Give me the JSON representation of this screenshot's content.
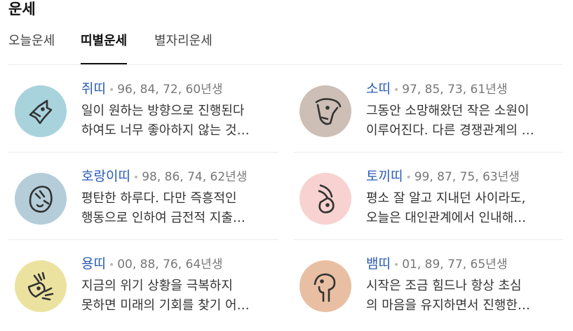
{
  "section_title": "운세",
  "tabs": [
    {
      "label": "오늘운세"
    },
    {
      "label": "띠별운세"
    },
    {
      "label": "별자리운세"
    }
  ],
  "active_tab": "띠별운세",
  "cards": [
    {
      "name": "쥐띠",
      "years": "96, 84, 72, 60년생",
      "line1": "일이 원하는 방향으로 진행된다",
      "line2": "하여도 너무 좋아하지 않는 것…",
      "icon": "rat-icon",
      "color": "#a8d3dc"
    },
    {
      "name": "소띠",
      "years": "97, 85, 73, 61년생",
      "line1": "그동안 소망해왔던 작은 소원이",
      "line2": "이루어진다. 다른 경쟁관계의 …",
      "icon": "ox-icon",
      "color": "#cdbfb6"
    },
    {
      "name": "호랑이띠",
      "years": "98, 86, 74, 62년생",
      "line1": "평탄한 하루다. 다만 즉흥적인",
      "line2": "행동으로 인하여 금전적 지출…",
      "icon": "tiger-icon",
      "color": "#b4cdd9"
    },
    {
      "name": "토끼띠",
      "years": "99, 87, 75, 63년생",
      "line1": "평소 잘 알고 지내던 사이라도,",
      "line2": "오늘은 대인관계에서 인내해…",
      "icon": "rabbit-icon",
      "color": "#f8d2d0"
    },
    {
      "name": "용띠",
      "years": "00, 88, 76, 64년생",
      "line1": "지금의 위기 상황을 극복하지",
      "line2": "못하면 미래의 기회를 찾기 어…",
      "icon": "dragon-icon",
      "color": "#ece2a0"
    },
    {
      "name": "뱀띠",
      "years": "01, 89, 77, 65년생",
      "line1": "시작은 조금 힘드나 항상 초심",
      "line2": "의 마음을 유지하면서 진행한…",
      "icon": "snake-icon",
      "color": "#e9bfa3"
    }
  ]
}
